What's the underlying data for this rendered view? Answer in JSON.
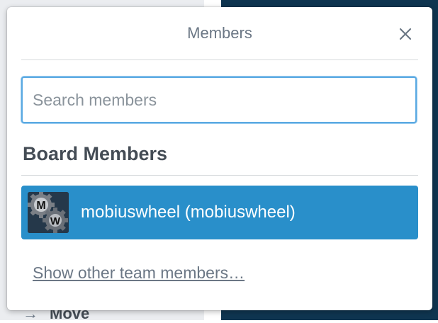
{
  "background": {
    "visible_text": "Move"
  },
  "popover": {
    "title": "Members",
    "close_icon": "close-icon"
  },
  "search": {
    "placeholder": "Search members",
    "value": ""
  },
  "board_members": {
    "heading": "Board Members",
    "members": [
      {
        "display": "mobiuswheel (mobiuswheel)",
        "avatar_initials": [
          "M",
          "W"
        ],
        "selected": true
      }
    ]
  },
  "footer": {
    "show_more_label": "Show other team members…"
  },
  "colors": {
    "accent": "#298fca",
    "focus_border": "#5aa9e2",
    "text_muted": "#6b7785",
    "heading": "#444c55",
    "board_background": "#0f3550"
  }
}
